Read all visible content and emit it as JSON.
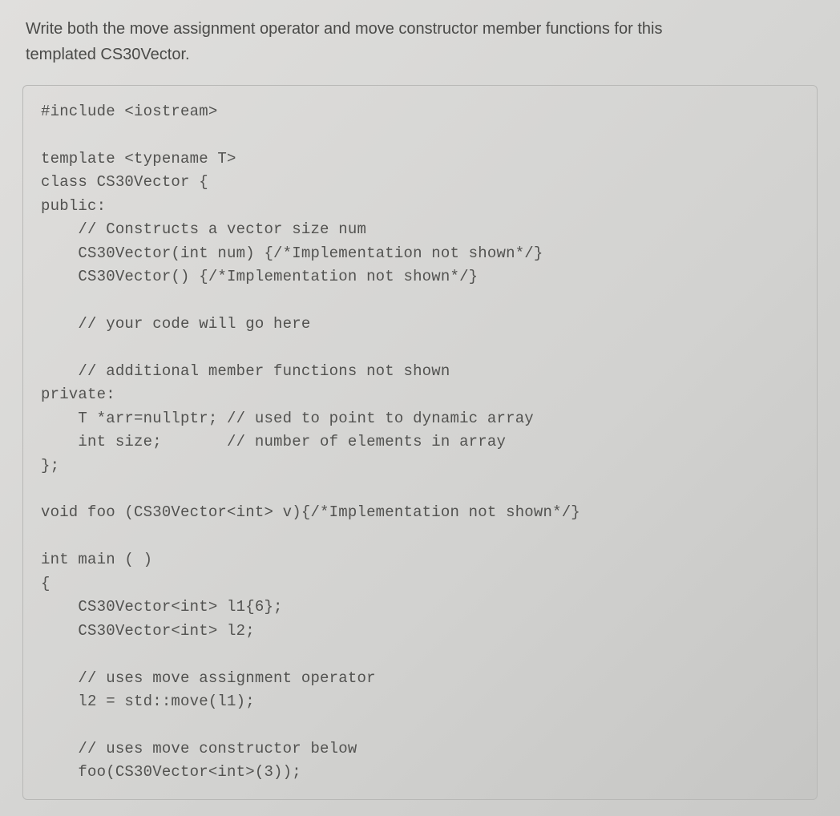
{
  "prompt": {
    "line1": "Write both the move assignment operator and move constructor member functions for this",
    "line2": "templated CS30Vector."
  },
  "code": {
    "l01": "#include <iostream>",
    "l02": "",
    "l03": "template <typename T>",
    "l04": "class CS30Vector {",
    "l05": "public:",
    "l06": "    // Constructs a vector size num",
    "l07": "    CS30Vector(int num) {/*Implementation not shown*/}",
    "l08": "    CS30Vector() {/*Implementation not shown*/}",
    "l09": "",
    "l10": "    // your code will go here",
    "l11": "",
    "l12": "    // additional member functions not shown",
    "l13": "private:",
    "l14": "    T *arr=nullptr; // used to point to dynamic array",
    "l15": "    int size;       // number of elements in array",
    "l16": "};",
    "l17": "",
    "l18": "void foo (CS30Vector<int> v){/*Implementation not shown*/}",
    "l19": "",
    "l20": "int main ( )",
    "l21": "{",
    "l22": "    CS30Vector<int> l1{6};",
    "l23": "    CS30Vector<int> l2;",
    "l24": "",
    "l25": "    // uses move assignment operator",
    "l26": "    l2 = std::move(l1);",
    "l27": "",
    "l28": "    // uses move constructor below",
    "l29": "    foo(CS30Vector<int>(3));"
  }
}
